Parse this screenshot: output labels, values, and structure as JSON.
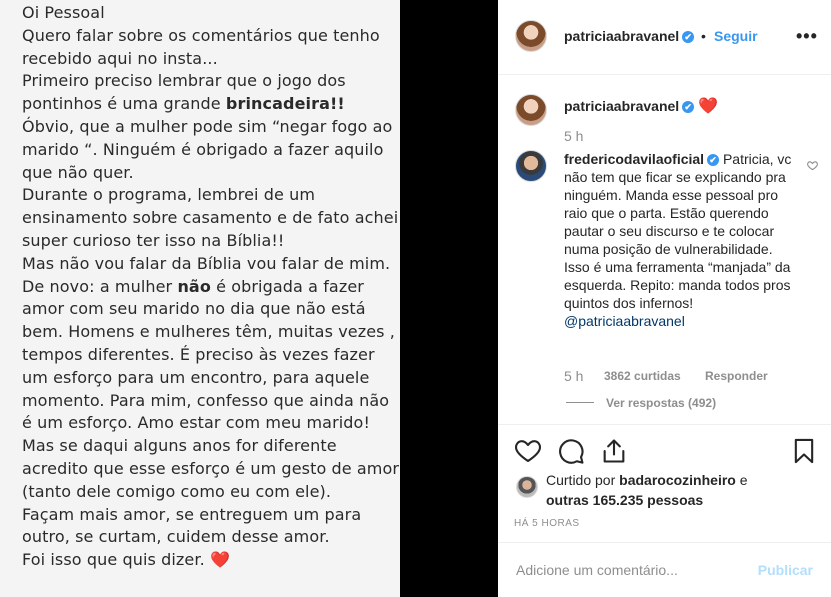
{
  "photo": {
    "lines": [
      {
        "text": "Oi Pessoal"
      },
      {
        "text": "Quero falar sobre os comentários que tenho"
      },
      {
        "text": "recebido aqui no insta..."
      },
      {
        "text": "Primeiro preciso lembrar que o jogo dos"
      },
      {
        "pre": "pontinhos é uma grande ",
        "bold": "brincadeira!!",
        "post": ""
      },
      {
        "text": "Óbvio, que a mulher pode sim “negar fogo ao"
      },
      {
        "text": "marido “. Ninguém é obrigado a fazer aquilo"
      },
      {
        "text": "que não quer."
      },
      {
        "text": "Durante o programa, lembrei de um"
      },
      {
        "text": "ensinamento sobre casamento e de fato achei"
      },
      {
        "text": "super curioso ter isso na Bíblia!!"
      },
      {
        "text": "Mas não vou falar da Bíblia vou falar de mim."
      },
      {
        "pre": "De novo: a mulher ",
        "bold": "não",
        "post": " é obrigada a fazer"
      },
      {
        "text": "amor com seu marido no dia que não está"
      },
      {
        "text": "bem. Homens e mulheres têm, muitas vezes ,"
      },
      {
        "text": "tempos diferentes. É preciso às vezes fazer"
      },
      {
        "text": "um esforço para um encontro, para aquele"
      },
      {
        "text": "momento. Para mim, confesso que ainda não"
      },
      {
        "text": "é um esforço. Amo estar com meu marido!"
      },
      {
        "text": "Mas se daqui alguns anos for diferente"
      },
      {
        "text": "acredito que esse esforço é um gesto de amor"
      },
      {
        "text": "(tanto dele comigo como eu com ele)."
      },
      {
        "text": "Façam mais amor, se entreguem um para"
      },
      {
        "text": "outro, se curtam, cuidem desse amor."
      },
      {
        "text": "Foi isso que quis dizer. ❤️"
      }
    ]
  },
  "header": {
    "username": "patriciaabravanel",
    "verified": "✔",
    "separator": "•",
    "follow_label": "Seguir",
    "more_label": "•••"
  },
  "caption": {
    "username": "patriciaabravanel",
    "text": "❤️",
    "time": "5 h"
  },
  "comment": {
    "username": "fredericodavilaoficial",
    "text": "Patricia, vc não tem que ficar se explicando pra ninguém. Manda esse pessoal pro raio que o parta. Estão querendo pautar o seu discurso e te colocar numa posição de vulnerabilidade. Isso é uma ferramenta “manjada” da esquerda. Repito: manda todos pros quintos dos infernos!",
    "mention": "@patriciaabravanel",
    "time": "5 h",
    "likes": "3862 curtidas",
    "reply_label": "Responder",
    "view_replies": "Ver respostas (492)"
  },
  "likes": {
    "prefix": "Curtido por",
    "user": "badarocozinheiro",
    "connector": "e",
    "others": "outras 165.235 pessoas"
  },
  "time_ago": "HÁ 5 HORAS",
  "add_comment": {
    "placeholder": "Adicione um comentário...",
    "publish_label": "Publicar"
  },
  "icons": {
    "like": "heart-icon",
    "comment": "comment-icon",
    "share": "share-icon",
    "save": "bookmark-icon"
  },
  "colors": {
    "accent": "#3897f0",
    "heart": "#ed4956",
    "muted": "#8e8e8e"
  }
}
